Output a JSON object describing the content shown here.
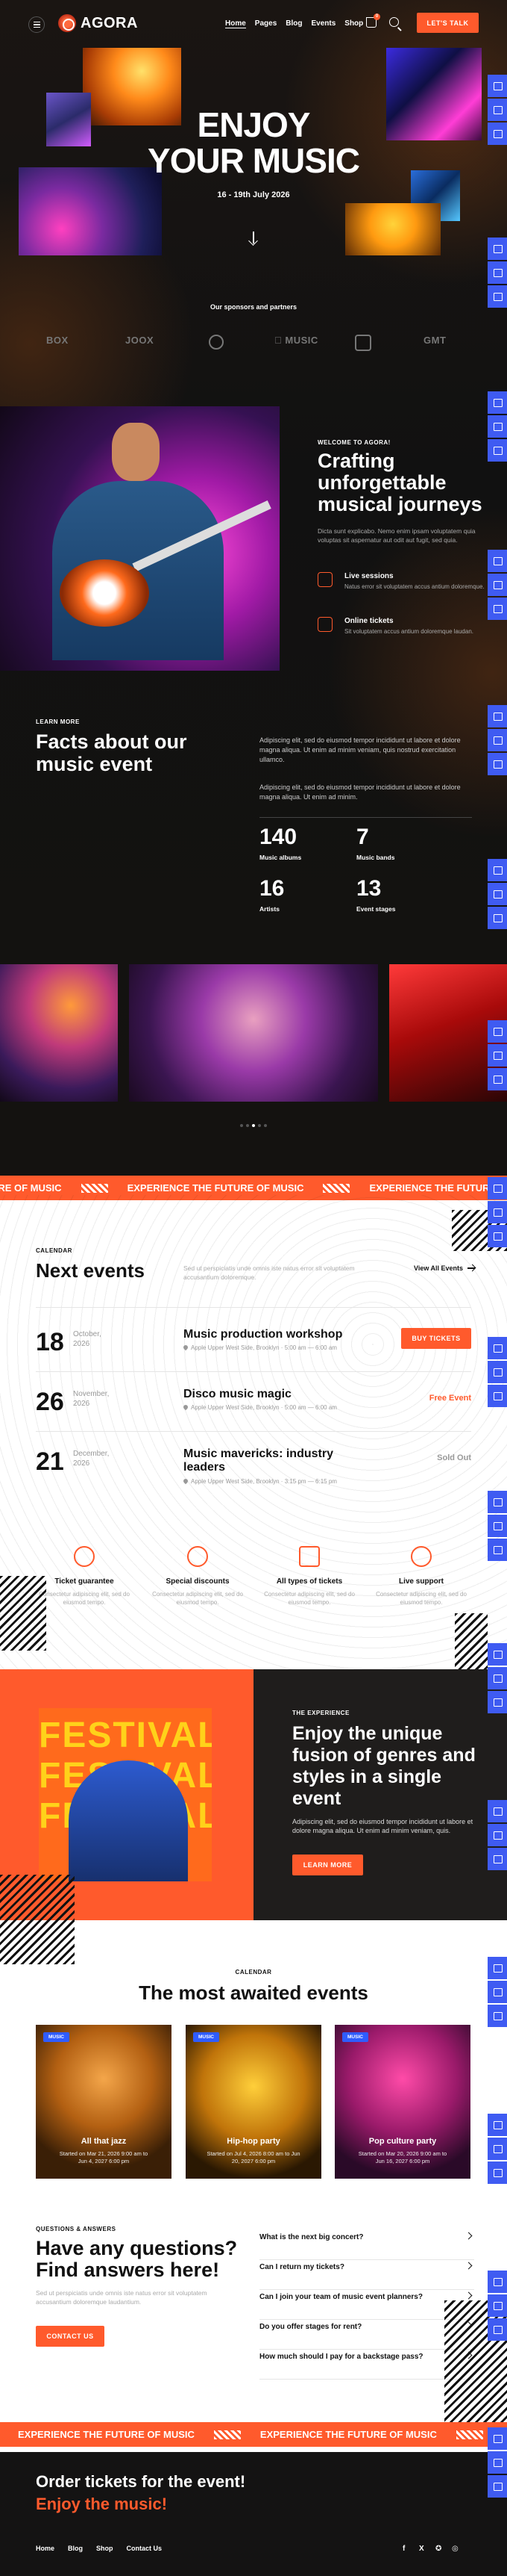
{
  "header": {
    "brand": "AGORA",
    "nav": [
      "Home",
      "Pages",
      "Blog",
      "Events",
      "Shop"
    ],
    "cart_count": "0",
    "cta": "LET'S TALK"
  },
  "hero": {
    "title_line1": "ENJOY",
    "title_line2": "YOUR MUSIC",
    "dates": "16 - 19th July 2026",
    "sponsors_title": "Our sponsors and partners",
    "sponsors": [
      "BOX",
      "JOOX",
      "",
      "MUSIC",
      "",
      "GMT"
    ]
  },
  "about": {
    "kicker": "WELCOME TO AGORA!",
    "title": "Crafting unforgettable musical journeys",
    "text": "Dicta sunt explicabo. Nemo enim ipsam voluptatem quia voluptas sit aspernatur aut odit aut fugit, sed quia.",
    "features": [
      {
        "title": "Live sessions",
        "text": "Natus error sit voluptatem accus antium doloremque."
      },
      {
        "title": "Online tickets",
        "text": "Sit voluptatem accus antium doloremque laudan."
      }
    ]
  },
  "facts": {
    "kicker": "LEARN MORE",
    "title": "Facts about our music event",
    "p1": "Adipiscing elit, sed do eiusmod tempor incididunt ut labore et dolore magna aliqua. Ut enim ad minim veniam, quis nostrud exercitation ullamco.",
    "p2": "Adipiscing elit, sed do eiusmod tempor incididunt ut labore et dolore magna aliqua. Ut enim ad minim.",
    "stats": [
      {
        "n": "140",
        "l": "Music albums"
      },
      {
        "n": "7",
        "l": "Music bands"
      },
      {
        "n": "16",
        "l": "Artists"
      },
      {
        "n": "13",
        "l": "Event stages"
      }
    ]
  },
  "marquee": {
    "text": "EXPERIENCE THE FUTURE OF MUSIC",
    "fragment": "TURE OF MUSIC"
  },
  "next_events": {
    "kicker": "CALENDAR",
    "title": "Next events",
    "text": "Sed ut perspiciatis unde omnis iste natus error sit voluptatem accusantium doloremque.",
    "view_all": "View All Events",
    "events": [
      {
        "day": "18",
        "month": "October,",
        "year": "2026",
        "name": "Music production workshop",
        "info": "Apple Upper West Side, Brooklyn   ·   5:00 am — 6:00 am",
        "action": "BUY TICKETS"
      },
      {
        "day": "26",
        "month": "November,",
        "year": "2026",
        "name": "Disco music magic",
        "info": "Apple Upper West Side, Brooklyn   ·   5:00 am — 6:00 am",
        "action": "Free Event"
      },
      {
        "day": "21",
        "month": "December,",
        "year": "2026",
        "name": "Music mavericks: industry leaders",
        "info": "Apple Upper West Side, Brooklyn   ·   3:15 pm — 6:15 pm",
        "action": "Sold Out"
      }
    ]
  },
  "guarantees": [
    {
      "title": "Ticket guarantee",
      "text": "Consectetur adipiscing elit, sed do eiusmod tempo."
    },
    {
      "title": "Special discounts",
      "text": "Consectetur adipiscing elit, sed do eiusmod tempo."
    },
    {
      "title": "All types of tickets",
      "text": "Consectetur adipiscing elit, sed do eiusmod tempo."
    },
    {
      "title": "Live support",
      "text": "Consectetur adipiscing elit, sed do eiusmod tempo."
    }
  ],
  "experience": {
    "poster_text": "FESTIVAL FESTIVAL FESTIVAL",
    "kicker": "THE EXPERIENCE",
    "title": "Enjoy the unique fusion of genres and styles in a single event",
    "text": "Adipiscing elit, sed do eiusmod tempor incididunt ut labore et dolore magna aliqua. Ut enim ad minim veniam, quis.",
    "cta": "LEARN MORE"
  },
  "awaited": {
    "kicker": "CALENDAR",
    "title": "The most awaited events",
    "cards": [
      {
        "tag": "MUSIC",
        "name": "All that jazz",
        "date": "Started on Mar 21, 2026 9:00 am to Jun 4, 2027 6:00 pm"
      },
      {
        "tag": "MUSIC",
        "name": "Hip-hop party",
        "date": "Started on Jul 4, 2026 8:00 am to Jun 20, 2027 6:00 pm"
      },
      {
        "tag": "MUSIC",
        "name": "Pop culture party",
        "date": "Started on Mar 20, 2026 9:00 am to Jun 16, 2027 6:00 pm"
      }
    ]
  },
  "faq": {
    "kicker": "QUESTIONS & ANSWERS",
    "title": "Have any questions? Find answers here!",
    "text": "Sed ut perspiciatis unde omnis iste natus error sit voluptatem accusantium doloremque laudantium.",
    "cta": "CONTACT US",
    "items": [
      "What is the next big concert?",
      "Can I return my tickets?",
      "Can I join your team of music event planners?",
      "Do you offer stages for rent?",
      "How much should I pay for a backstage pass?"
    ]
  },
  "footer": {
    "line1": "Order tickets for the event!",
    "line2": "Enjoy the music!",
    "links": [
      "Home",
      "Blog",
      "Shop",
      "Contact Us"
    ],
    "social": [
      "f",
      "X",
      "✪",
      "◎"
    ]
  },
  "colors": {
    "accent": "#ff5a2c",
    "rail": "#3f5bf2",
    "dark": "#141313"
  }
}
